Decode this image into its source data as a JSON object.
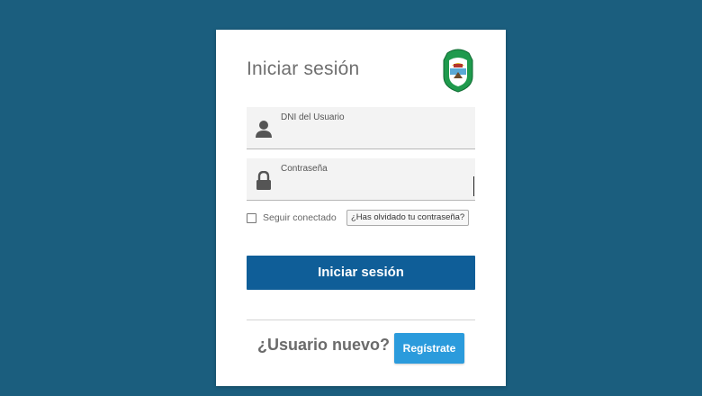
{
  "login": {
    "title": "Iniciar sesión",
    "dni_label": "DNI del Usuario",
    "password_label": "Contraseña",
    "remember_label": "Seguir conectado",
    "forgot_label": "¿Has olvidado tu contraseña?",
    "submit_label": "Iniciar sesión"
  },
  "register": {
    "prompt": "¿Usuario nuevo?",
    "button_label": "Regístrate"
  },
  "icons": {
    "crest": "province-crest-icon",
    "user": "user-icon",
    "password": "lock-icon"
  },
  "colors": {
    "background": "#1b5e7e",
    "primary_button": "#0f5e98",
    "register_button": "#2b9bdc",
    "crest_green": "#1f9a4d"
  }
}
